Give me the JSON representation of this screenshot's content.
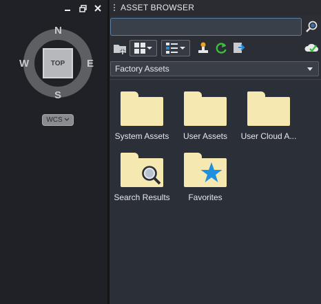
{
  "viewport": {
    "compass": {
      "top_label": "TOP",
      "north": "N",
      "south": "S",
      "west": "W",
      "east": "E"
    },
    "wcs_label": "WCS"
  },
  "panel": {
    "title": "ASSET BROWSER",
    "search": {
      "value": "",
      "placeholder": ""
    },
    "library_dropdown": {
      "selected": "Factory Assets"
    },
    "folders": [
      {
        "label": "System Assets",
        "icon": "folder-icon"
      },
      {
        "label": "User Assets",
        "icon": "folder-icon"
      },
      {
        "label": "User Cloud A...",
        "icon": "folder-icon"
      },
      {
        "label": "Search Results",
        "icon": "folder-search-icon"
      },
      {
        "label": "Favorites",
        "icon": "folder-star-icon"
      }
    ]
  },
  "colors": {
    "folder": "#f6e8b1",
    "star": "#1f8fe0",
    "accent_green": "#3cc13c"
  }
}
